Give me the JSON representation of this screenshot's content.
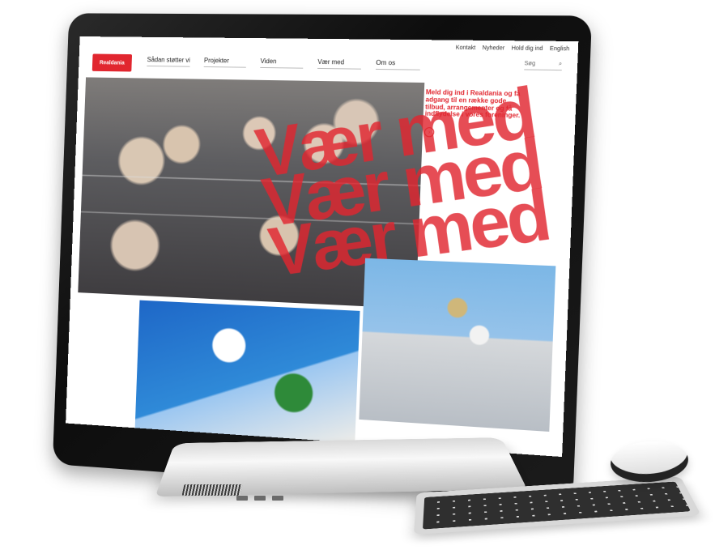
{
  "screen": {
    "top_links": [
      "Kontakt",
      "Nyheder",
      "Hold dig ind",
      "English"
    ],
    "logo_text": "Realdania",
    "nav": [
      "Sådan støtter vi",
      "Projekter",
      "Viden",
      "Vær med",
      "Om os"
    ],
    "search_placeholder": "Søg",
    "headline": "Meld dig ind i Realdania og få adgang til en række gode tilbud, arrangementer og få indflydelse i vores foreninger.",
    "hero_text": [
      "Vær med",
      "Vær med",
      "Vær med"
    ]
  },
  "colors": {
    "brand": "#e1262f"
  },
  "icons": {
    "search": "search-icon",
    "arrow": "arrow-right-icon"
  }
}
